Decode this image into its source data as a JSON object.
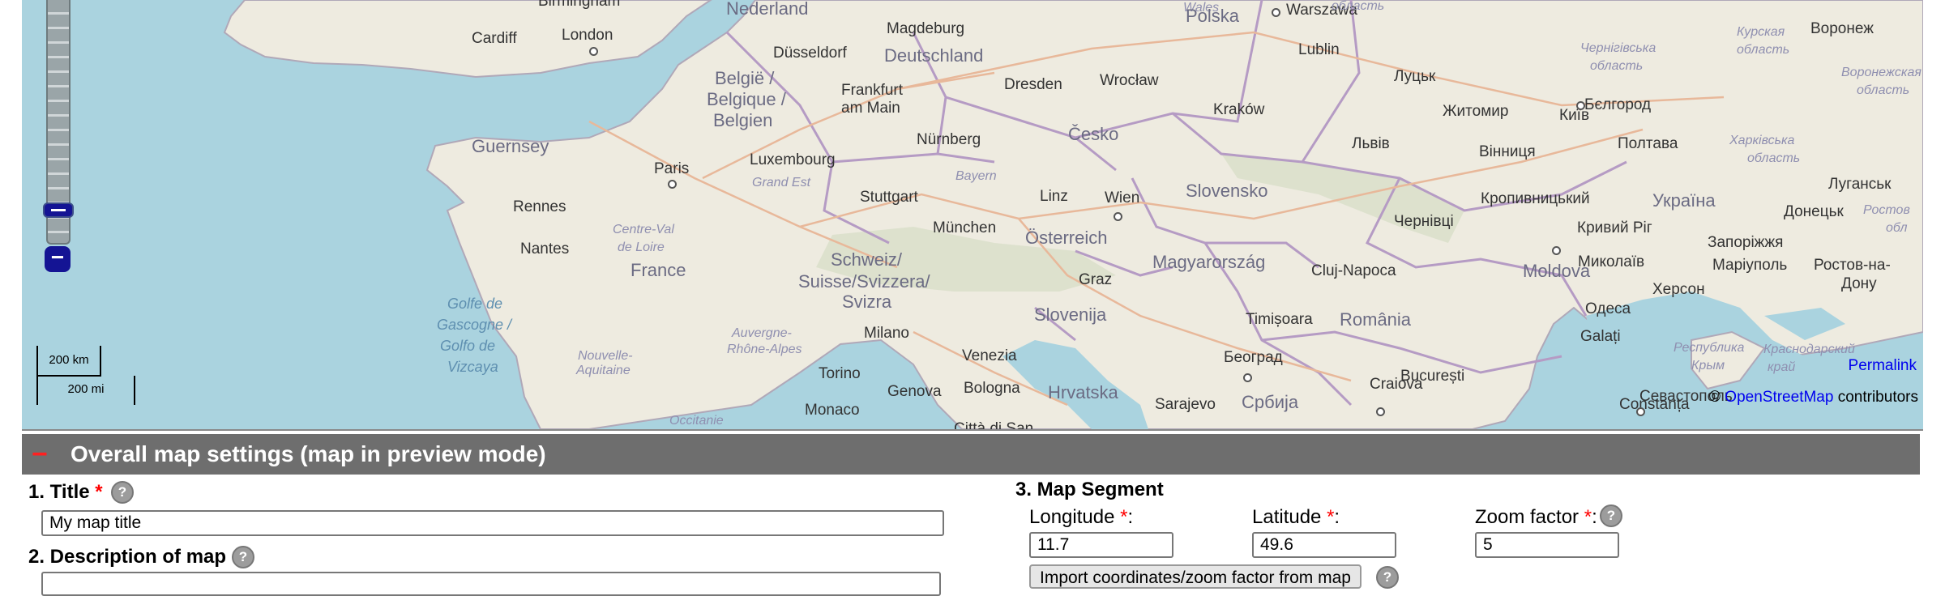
{
  "map": {
    "places": [
      {
        "t": "Wales",
        "cls": "region"
      },
      {
        "t": "Birmingham",
        "cls": ""
      },
      {
        "t": "Cardiff",
        "cls": ""
      },
      {
        "t": "London",
        "cls": ""
      },
      {
        "t": "Nederland",
        "cls": "country"
      },
      {
        "t": "Magdeburg",
        "cls": ""
      },
      {
        "t": "Düsseldorf",
        "cls": ""
      },
      {
        "t": "Deutschland",
        "cls": "country"
      },
      {
        "t": "België /",
        "cls": "country"
      },
      {
        "t": "Belgique /",
        "cls": "country"
      },
      {
        "t": "Belgien",
        "cls": "country"
      },
      {
        "t": "Frankfurt",
        "cls": ""
      },
      {
        "t": "am Main",
        "cls": ""
      },
      {
        "t": "Dresden",
        "cls": ""
      },
      {
        "t": "Wrocław",
        "cls": ""
      },
      {
        "t": "Polska",
        "cls": "country"
      },
      {
        "t": "Warszawa",
        "cls": ""
      },
      {
        "t": "Lublin",
        "cls": ""
      },
      {
        "t": "Луцьк",
        "cls": ""
      },
      {
        "t": "Guernsey",
        "cls": "country"
      },
      {
        "t": "Paris",
        "cls": ""
      },
      {
        "t": "Luxembourg",
        "cls": ""
      },
      {
        "t": "Grand Est",
        "cls": "region"
      },
      {
        "t": "Nürnberg",
        "cls": ""
      },
      {
        "t": "Česko",
        "cls": "country"
      },
      {
        "t": "Kraków",
        "cls": ""
      },
      {
        "t": "Львів",
        "cls": ""
      },
      {
        "t": "Житомир",
        "cls": ""
      },
      {
        "t": "Київ",
        "cls": ""
      },
      {
        "t": "Бєлгород",
        "cls": ""
      },
      {
        "t": "Воронеж",
        "cls": ""
      },
      {
        "t": "Bayern",
        "cls": "region"
      },
      {
        "t": "Stuttgart",
        "cls": ""
      },
      {
        "t": "Linz",
        "cls": ""
      },
      {
        "t": "Wien",
        "cls": ""
      },
      {
        "t": "Slovensko",
        "cls": "country"
      },
      {
        "t": "Вінниця",
        "cls": ""
      },
      {
        "t": "Полтава",
        "cls": ""
      },
      {
        "t": "Rennes",
        "cls": ""
      },
      {
        "t": "München",
        "cls": ""
      },
      {
        "t": "Centre-Val",
        "cls": "region"
      },
      {
        "t": "de Loire",
        "cls": "region"
      },
      {
        "t": "Кропивницький",
        "cls": ""
      },
      {
        "t": "Україна",
        "cls": "country"
      },
      {
        "t": "Луганськ",
        "cls": ""
      },
      {
        "t": "Чернівці",
        "cls": ""
      },
      {
        "t": "Донецьк",
        "cls": ""
      },
      {
        "t": "Nantes",
        "cls": ""
      },
      {
        "t": "Österreich",
        "cls": "country"
      },
      {
        "t": "Кривий Ріг",
        "cls": ""
      },
      {
        "t": "Schweiz/",
        "cls": "country"
      },
      {
        "t": "Suisse/Svizzera/",
        "cls": "country"
      },
      {
        "t": "Svizra",
        "cls": "country"
      },
      {
        "t": "France",
        "cls": "country"
      },
      {
        "t": "Magyarország",
        "cls": "country"
      },
      {
        "t": "Cluj-Napoca",
        "cls": ""
      },
      {
        "t": "Moldova",
        "cls": "country"
      },
      {
        "t": "Миколаїв",
        "cls": ""
      },
      {
        "t": "Запоріжжя",
        "cls": ""
      },
      {
        "t": "Маріуполь",
        "cls": ""
      },
      {
        "t": "Ростов-на-",
        "cls": ""
      },
      {
        "t": "Дону",
        "cls": ""
      },
      {
        "t": "Graz",
        "cls": ""
      },
      {
        "t": "Херсон",
        "cls": ""
      },
      {
        "t": "Golfe de",
        "cls": "sea"
      },
      {
        "t": "Gascogne /",
        "cls": "sea"
      },
      {
        "t": "Golfo de",
        "cls": "sea"
      },
      {
        "t": "Vizcaya",
        "cls": "sea"
      },
      {
        "t": "Slovenija",
        "cls": "country"
      },
      {
        "t": "Одеса",
        "cls": ""
      },
      {
        "t": "Timișoara",
        "cls": ""
      },
      {
        "t": "România",
        "cls": "country"
      },
      {
        "t": "Milano",
        "cls": ""
      },
      {
        "t": "Galați",
        "cls": ""
      },
      {
        "t": "Auvergne-",
        "cls": "region"
      },
      {
        "t": "Rhône-Alpes",
        "cls": "region"
      },
      {
        "t": "Nouvelle-",
        "cls": "region"
      },
      {
        "t": "Aquitaine",
        "cls": "region"
      },
      {
        "t": "Venezia",
        "cls": ""
      },
      {
        "t": "Београд",
        "cls": ""
      },
      {
        "t": "Республика",
        "cls": "region"
      },
      {
        "t": "Крым",
        "cls": "region"
      },
      {
        "t": "Краснодарский",
        "cls": "region"
      },
      {
        "t": "край",
        "cls": "region"
      },
      {
        "t": "Torino",
        "cls": ""
      },
      {
        "t": "București",
        "cls": ""
      },
      {
        "t": "Craiova",
        "cls": ""
      },
      {
        "t": "Genova",
        "cls": ""
      },
      {
        "t": "Bologna",
        "cls": ""
      },
      {
        "t": "Hrvatska",
        "cls": "country"
      },
      {
        "t": "Sarajevo",
        "cls": ""
      },
      {
        "t": "Србија",
        "cls": "country"
      },
      {
        "t": "Constanța",
        "cls": ""
      },
      {
        "t": "Севастополь",
        "cls": ""
      },
      {
        "t": "Monaco",
        "cls": ""
      },
      {
        "t": "Occitanie",
        "cls": "region"
      },
      {
        "t": "Città di San",
        "cls": ""
      },
      {
        "t": "область",
        "cls": "region"
      },
      {
        "t": "Курская",
        "cls": "region"
      },
      {
        "t": "область",
        "cls": "region"
      },
      {
        "t": "Воронежская",
        "cls": "region"
      },
      {
        "t": "область",
        "cls": "region"
      },
      {
        "t": "Чернігівська",
        "cls": "region"
      },
      {
        "t": "область",
        "cls": "region"
      },
      {
        "t": "Харківська",
        "cls": "region"
      },
      {
        "t": "область",
        "cls": "region"
      },
      {
        "t": "Ростов",
        "cls": "region"
      },
      {
        "t": "обл",
        "cls": "region"
      }
    ],
    "scale_km": "200 km",
    "scale_mi": "200 mi",
    "permalink": "Permalink",
    "attribution_prefix": "©",
    "attribution_link": "OpenStreetMap",
    "attribution_suffix": "contributors"
  },
  "settings": {
    "collapse_symbol": "−",
    "header": "Overall map settings (map in preview mode)",
    "title_label": "1. Title",
    "title_value": "My map title",
    "desc_label": "2. Description of map",
    "segment_label": "3. Map Segment",
    "longitude_label": "Longitude",
    "longitude_value": "11.7",
    "latitude_label": "Latitude",
    "latitude_value": "49.6",
    "zoom_label": "Zoom factor",
    "zoom_value": "5",
    "required_mark": "*",
    "colon": ":",
    "help_symbol": "?",
    "import_button": "Import coordinates/zoom factor from map"
  },
  "colors": {
    "sea": "#aad3df",
    "land": "#eeebe0",
    "header_bg": "#6e6e6e",
    "zoom_blue": "#141494",
    "required": "#ff0000"
  }
}
